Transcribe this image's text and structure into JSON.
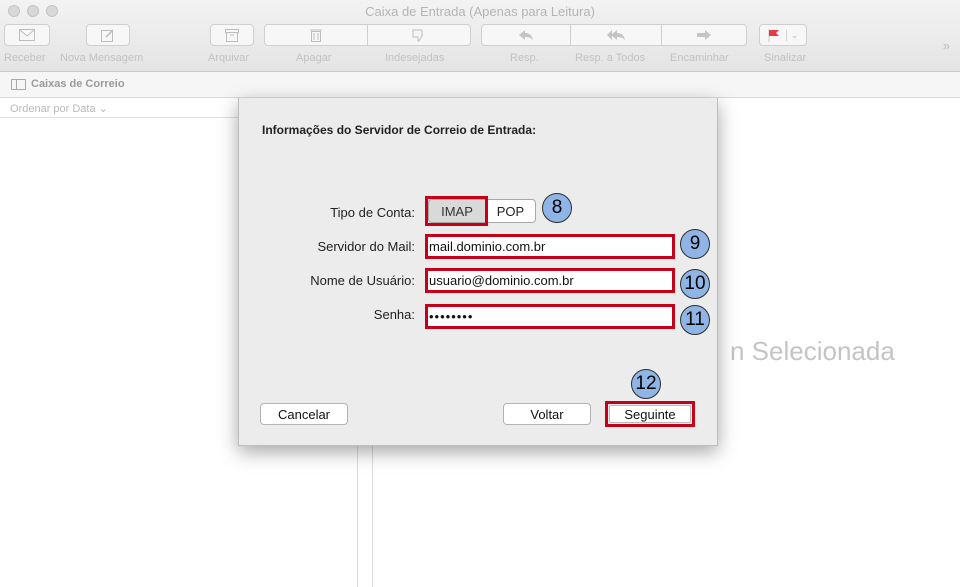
{
  "window": {
    "title": "Caixa de Entrada (Apenas para Leitura)"
  },
  "toolbar": {
    "receive": "Receber",
    "new_message": "Nova Mensagem",
    "archive": "Arquivar",
    "delete": "Apagar",
    "junk": "Indesejadas",
    "reply": "Resp.",
    "reply_all": "Resp. a Todos",
    "forward": "Encaminhar",
    "flag": "Sinalizar",
    "overflow": "»"
  },
  "mailboxes": {
    "label": "Caixas de Correio"
  },
  "sort": {
    "label": "Ordenar por Data ⌄"
  },
  "viewer": {
    "message": "n Selecionada"
  },
  "dialog": {
    "title": "Informações do Servidor de Correio de Entrada:",
    "account_type_label": "Tipo de Conta:",
    "imap": "IMAP",
    "pop": "POP",
    "mail_server_label": "Servidor do Mail:",
    "mail_server_value": "mail.dominio.com.br",
    "username_label": "Nome de Usuário:",
    "username_value": "usuario@dominio.com.br",
    "password_label": "Senha:",
    "password_value": "••••••••",
    "cancel": "Cancelar",
    "back": "Voltar",
    "next": "Seguinte"
  },
  "annotations": {
    "step8": "8",
    "step9": "9",
    "step10": "10",
    "step11": "11",
    "step12": "12"
  },
  "colors": {
    "highlight": "#c4001b",
    "badge": "#8fb5e6",
    "flag": "#e83a44"
  }
}
